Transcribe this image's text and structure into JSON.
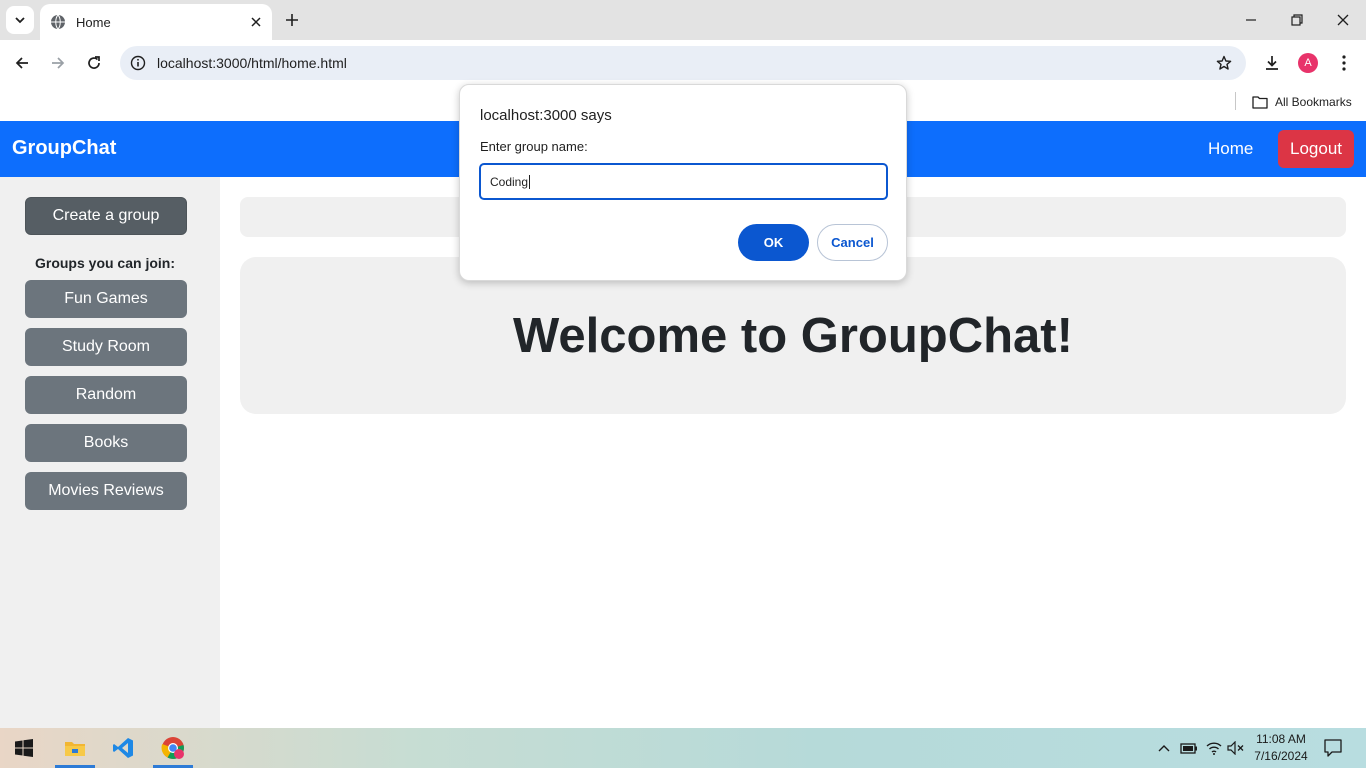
{
  "browser": {
    "tab_title": "Home",
    "url": "localhost:3000/html/home.html",
    "bookmarks_label": "All Bookmarks",
    "profile_initial": "A"
  },
  "navbar": {
    "brand": "GroupChat",
    "home_label": "Home",
    "logout_label": "Logout",
    "accent_color": "#0d6efd",
    "logout_color": "#dc3545"
  },
  "sidebar": {
    "create_label": "Create a group",
    "groups_heading": "Groups you can join:",
    "groups": [
      "Fun Games",
      "Study Room",
      "Random",
      "Books",
      "Movies Reviews"
    ]
  },
  "main": {
    "welcome_text": "Welcome to GroupChat!"
  },
  "dialog": {
    "title": "localhost:3000 says",
    "message": "Enter group name:",
    "input_value": "Coding",
    "ok_label": "OK",
    "cancel_label": "Cancel"
  },
  "taskbar": {
    "time": "11:08 AM",
    "date": "7/16/2024",
    "apps": [
      "start-icon",
      "file-explorer-icon",
      "vscode-icon",
      "chrome-icon"
    ]
  }
}
